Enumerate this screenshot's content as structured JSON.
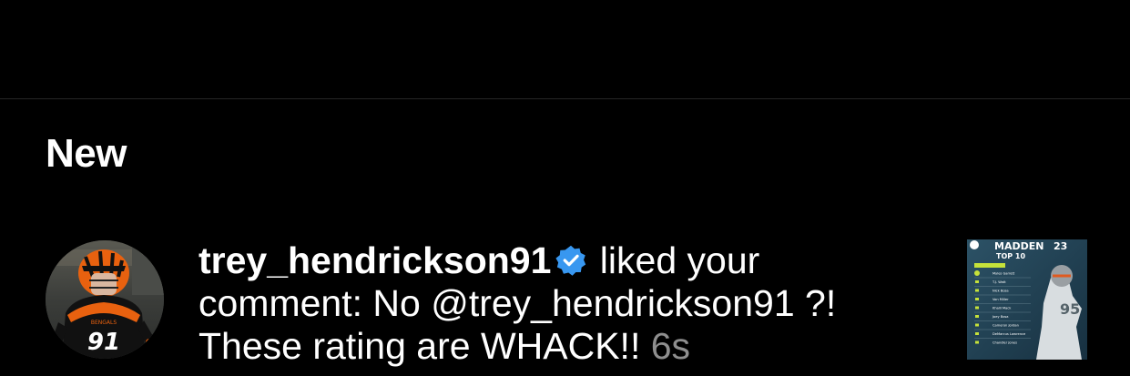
{
  "section": {
    "title": "New"
  },
  "notification": {
    "username": "trey_hendrickson91",
    "verified_icon": "verified-badge-icon",
    "action_text": " liked your comment: ",
    "comment_text": "No @trey_hendrickson91 ?! These rating are WHACK!!",
    "time": "6s",
    "avatar_number": "91",
    "avatar_team": "BENGALS"
  },
  "thumbnail": {
    "brand": "MADDEN",
    "edition": "23",
    "title": "TOP 10",
    "players": [
      "Myles Garrett",
      "T.J. Watt",
      "Nick Bosa",
      "Von Miller",
      "Khalil Mack",
      "Joey Bosa",
      "Cameron Jordan",
      "DeMarcus Lawrence",
      "Chandler Jones"
    ],
    "jersey": "95"
  },
  "colors": {
    "background": "#000000",
    "text": "#ffffff",
    "muted": "#8e8e8e",
    "verified": "#3897f0",
    "bengals_orange": "#fb4f14"
  }
}
